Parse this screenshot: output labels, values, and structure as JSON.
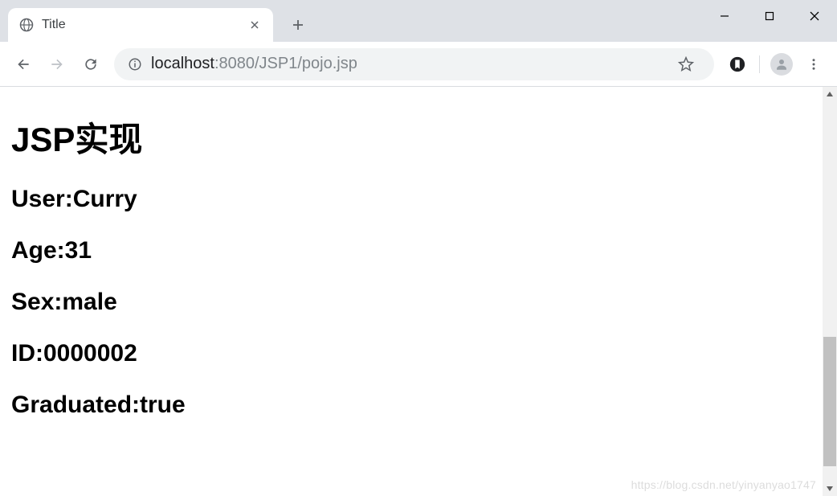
{
  "window": {
    "controls": {
      "minimize": "—",
      "maximize": "▢",
      "close": "✕"
    }
  },
  "tab": {
    "title": "Title",
    "new_tab_label": "+"
  },
  "toolbar": {
    "url_host_dark": "localhost",
    "url_rest_dim": ":8080/JSP1/pojo.jsp"
  },
  "content": {
    "heading": "JSP实现",
    "rows": {
      "user": "User:Curry",
      "age": "Age:31",
      "sex": "Sex:male",
      "id": "ID:0000002",
      "graduated": "Graduated:true"
    }
  },
  "watermark": "https://blog.csdn.net/yinyanyao1747"
}
